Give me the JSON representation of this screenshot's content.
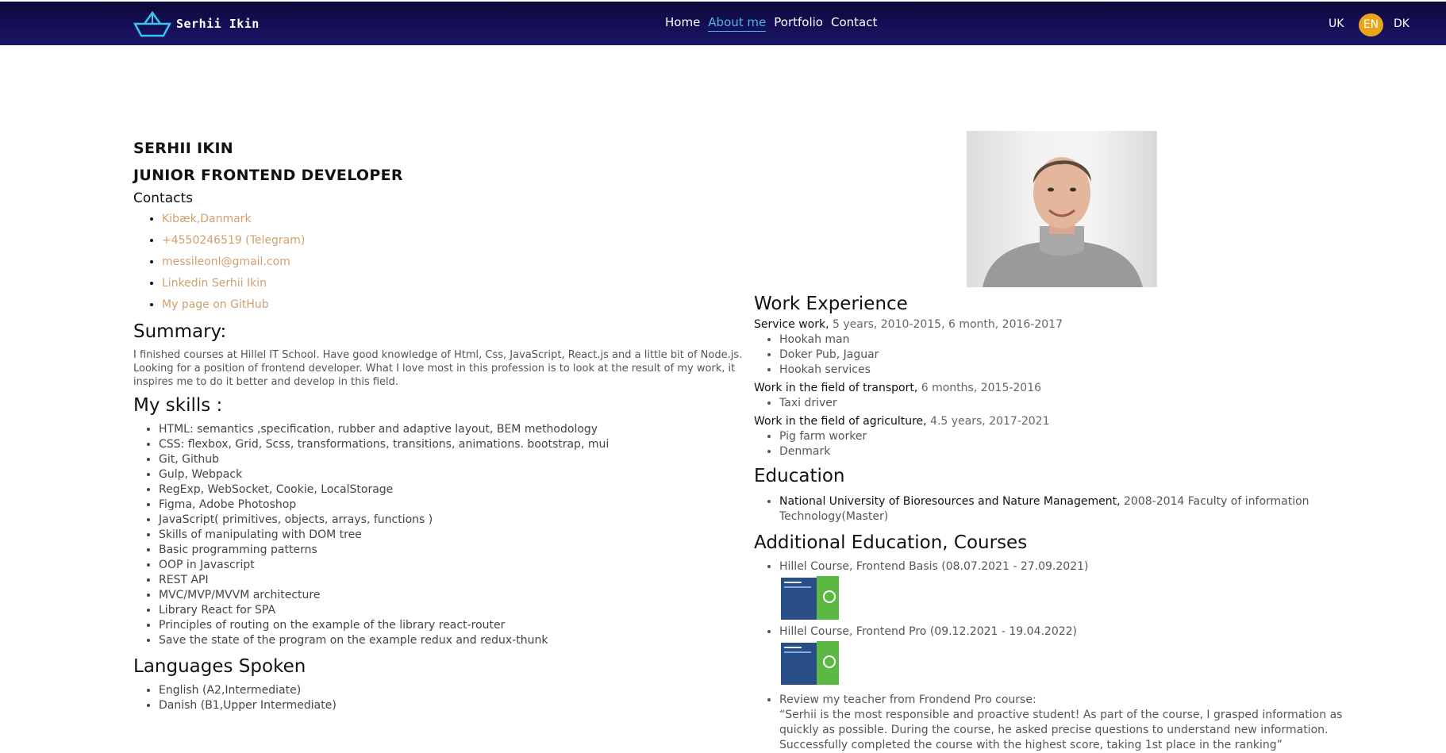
{
  "header": {
    "logo_text": "Serhii Ikin",
    "nav": [
      {
        "label": "Home"
      },
      {
        "label": "About me",
        "active": true
      },
      {
        "label": "Portfolio"
      },
      {
        "label": "Contact"
      }
    ],
    "languages": [
      "UK",
      "EN",
      "DK"
    ],
    "selected_language": "EN",
    "accent_color": "#4fb3e8",
    "language_badge_color": "#e9a519"
  },
  "profile": {
    "name": "SERHII IKIN",
    "role": "JUNIOR FRONTEND DEVELOPER",
    "contacts_title": "Contacts",
    "contacts": [
      "Kibæk,Danmark",
      "+4550246519 (Telegram)",
      "messileonl@gmail.com",
      "Linkedin Serhii Ikin",
      "My page on GitHub"
    ],
    "link_color": "#d1a06f"
  },
  "summary": {
    "title": "Summary:",
    "text": "I finished courses at Hillel IT School. Have good knowledge of Html, Css, JavaScript, React.js and a little bit of Node.js. Looking for a position of frontend developer. What I love most in this profession is to look at the result of my work, it inspires me to do it better and develop in this field."
  },
  "skills": {
    "title": "My skills :",
    "items": [
      "HTML: semantics ,specification, rubber and adaptive layout, BEM methodology",
      "CSS: flexbox, Grid, Scss, transformations, transitions, animations. bootstrap, mui",
      "Git, Github",
      "Gulp, Webpack",
      "RegExp, WebSocket, Cookie, LocalStorage",
      "Figma, Adobe Photoshop",
      "JavaScript( primitives, objects, arrays, functions )",
      "Skills of manipulating with DOM tree",
      "Basic programming patterns",
      "OOP in Javascript",
      "REST API",
      "MVC/MVP/MVVM architecture",
      "Library React for SPA",
      "Principles of routing on the example of the library react-router",
      "Save the state of the program on the example redux and redux-thunk"
    ]
  },
  "languages_spoken": {
    "title": "Languages Spoken",
    "items": [
      "English (A2,Intermediate)",
      "Danish (B1,Upper Intermediate)"
    ]
  },
  "work": {
    "title": "Work Experience",
    "jobs": [
      {
        "field": "Service work,",
        "period": " 5 years, 2010-2015, 6 month, 2016-2017",
        "items": [
          "Hookah man",
          "Doker Pub, Jaguar",
          "Hookah services"
        ]
      },
      {
        "field": "Work in the field of transport,",
        "period": " 6 months, 2015-2016",
        "items": [
          "Taxi driver"
        ]
      },
      {
        "field": "Work in the field of agriculture,",
        "period": " 4.5 years, 2017-2021",
        "items": [
          "Pig farm worker",
          "Denmark"
        ]
      }
    ]
  },
  "education": {
    "title": "Education",
    "institution": "National University of Bioresources and Nature Management,",
    "details": " 2008-2014 Faculty of information Technology(Master)"
  },
  "courses": {
    "title": "Additional Education, Courses",
    "items": [
      "Hillel Course, Frontend Basis (08.07.2021 - 27.09.2021)",
      "Hillel Course, Frontend Pro (09.12.2021 - 19.04.2022)"
    ],
    "review_label": "Review my teacher from Frondend Pro course:",
    "review_text": "“Serhii is the most responsible and proactive student! As part of the course, I grasped information as quickly as possible. During the course, he asked precise questions to understand new information. Successfully completed the course with the highest score, taking 1st place in the ranking”"
  }
}
